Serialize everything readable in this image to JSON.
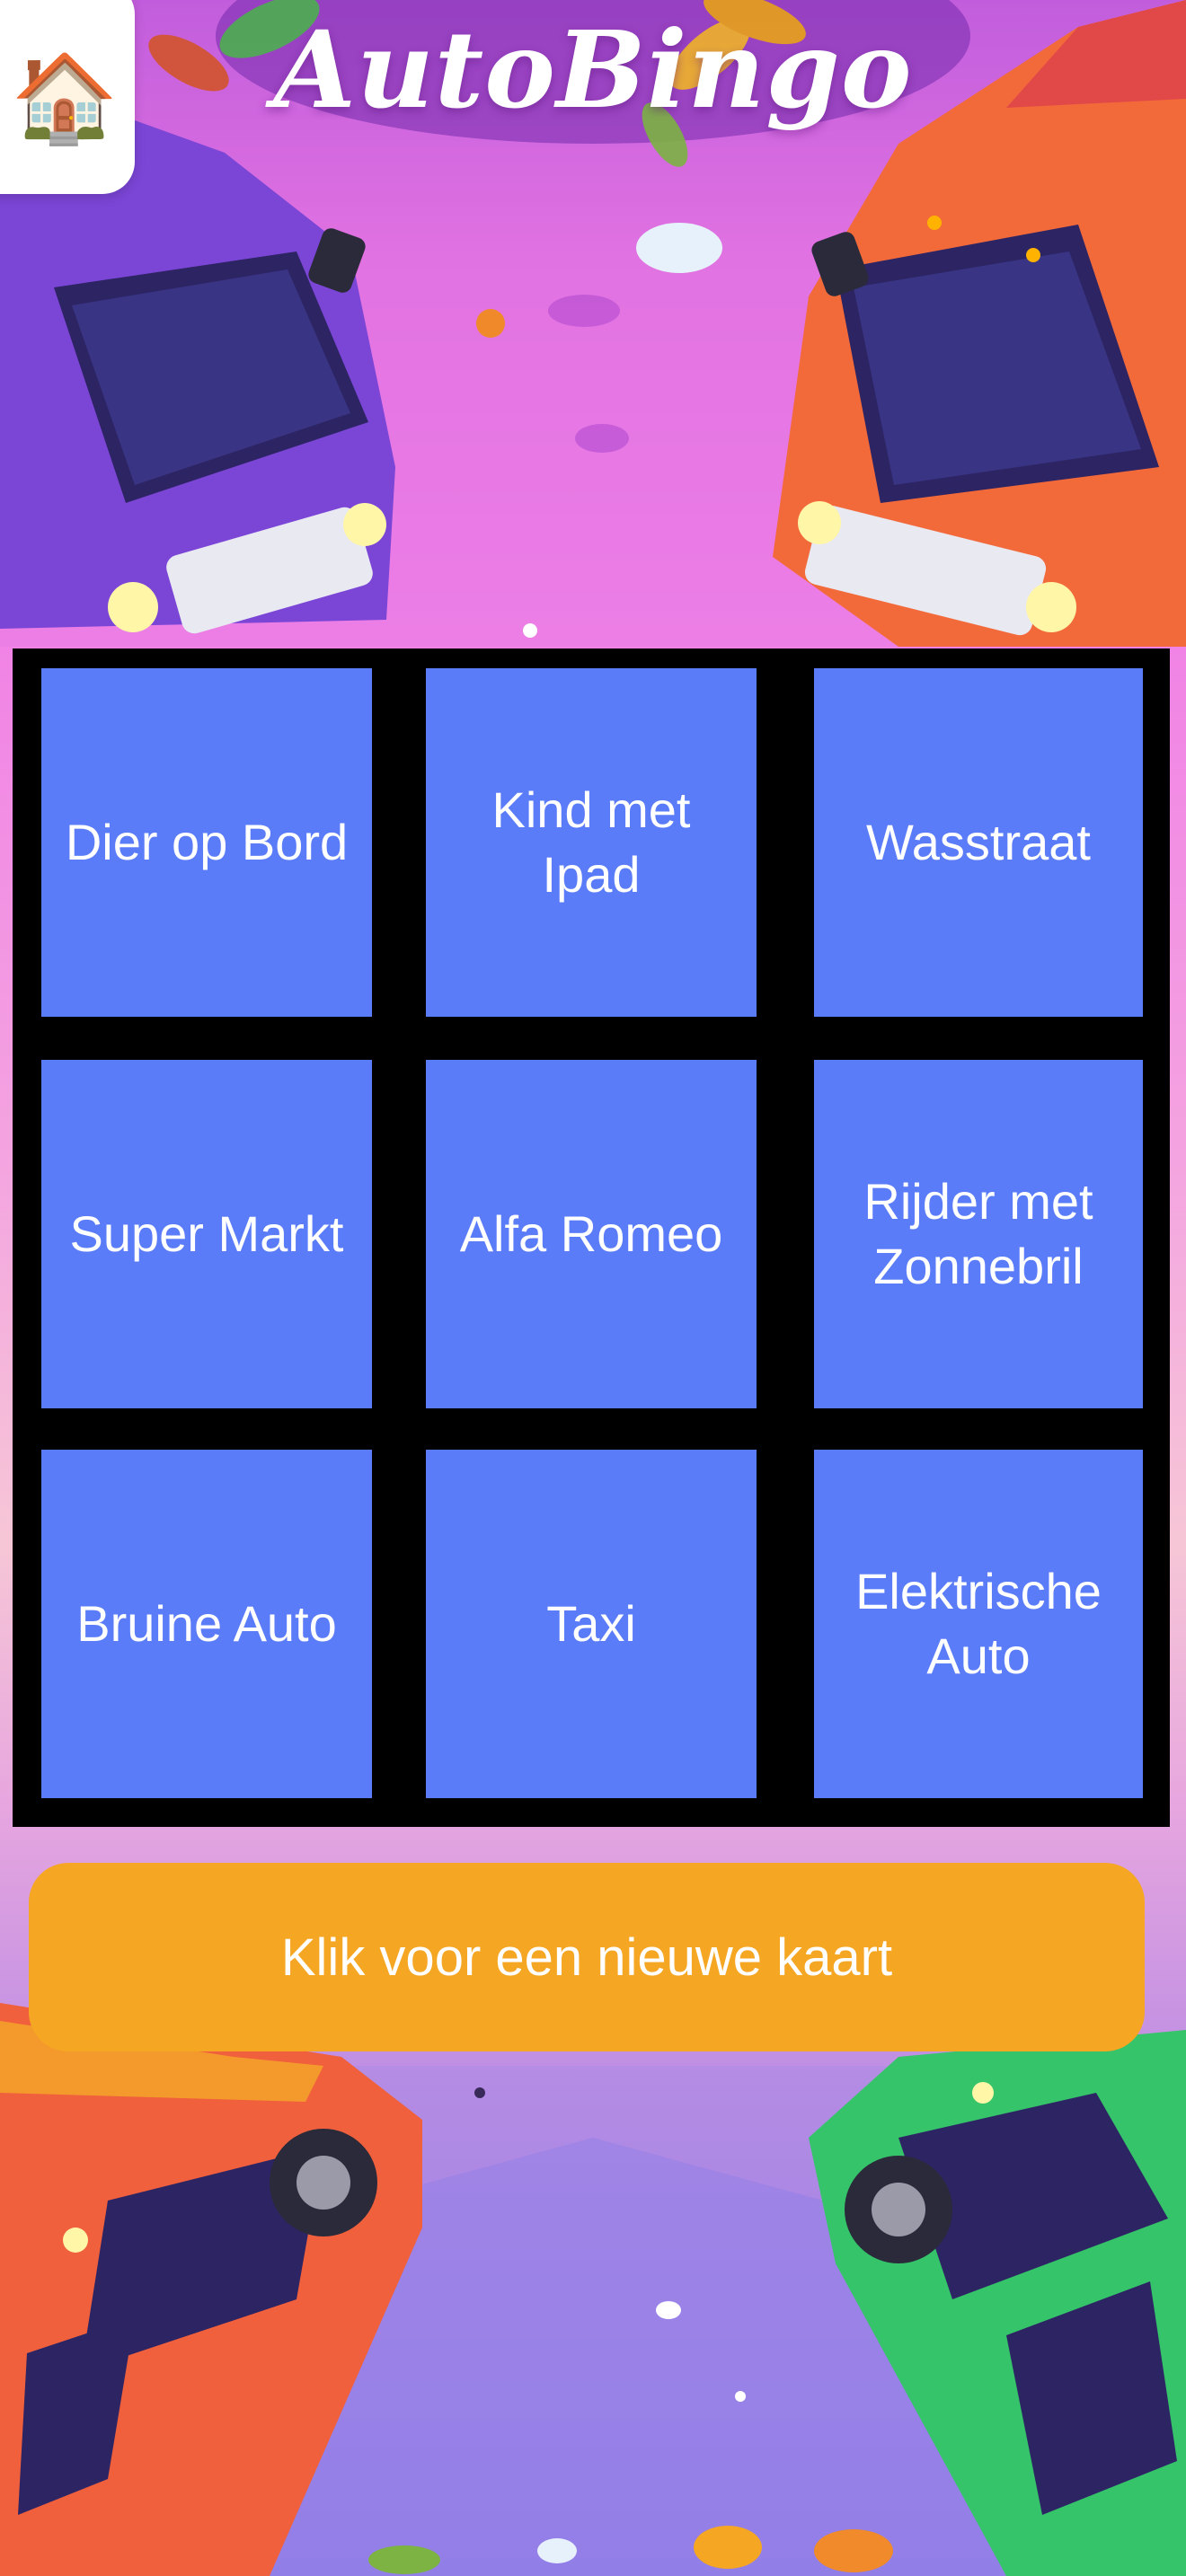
{
  "app": {
    "title": "AutoBingo",
    "home_icon": "🏠"
  },
  "bingo_card": {
    "cells": [
      "Dier op Bord",
      "Kind met Ipad",
      "Wasstraat",
      "Super Markt",
      "Alfa Romeo",
      "Rijder met Zonnebril",
      "Bruine Auto",
      "Taxi",
      "Elektrische Auto"
    ]
  },
  "actions": {
    "new_card_label": "Klik voor een nieuwe kaart"
  },
  "colors": {
    "cell": "#5b7cf8",
    "grid": "#000000",
    "button": "#f5a623"
  }
}
